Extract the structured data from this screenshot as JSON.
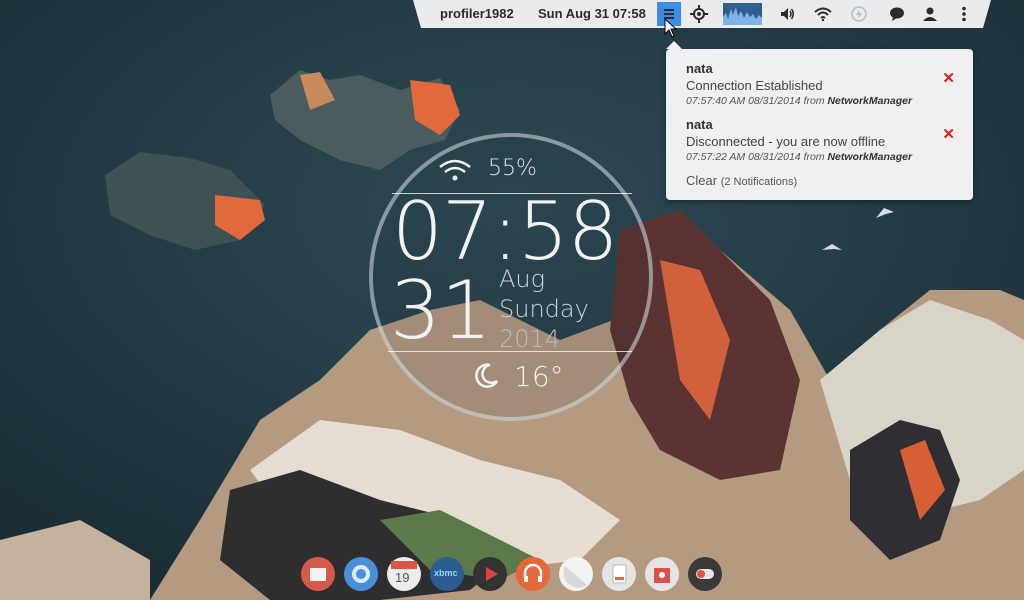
{
  "panel": {
    "user": "profiler1982",
    "datetime": "Sun Aug 31 07:58",
    "icons": [
      "menu-icon",
      "location-icon",
      "system-monitor-graph",
      "volume-icon",
      "wifi-icon",
      "power-icon",
      "chat-icon",
      "user-icon",
      "more-icon"
    ]
  },
  "notifications": {
    "items": [
      {
        "sender": "nata",
        "body": "Connection Established",
        "time": "07:57:40 AM 08/31/2014",
        "from_word": "from",
        "source": "NetworkManager"
      },
      {
        "sender": "nata",
        "body": "Disconnected - you are now offline",
        "time": "07:57:22 AM 08/31/2014",
        "from_word": "from",
        "source": "NetworkManager"
      }
    ],
    "clear_label": "Clear",
    "count_label": "(2 Notifications)"
  },
  "clock": {
    "wifi_percent": "55%",
    "time_hours": "07",
    "time_sep": ":",
    "time_minutes": "58",
    "day": "31",
    "month": "Aug",
    "weekday": "Sunday",
    "year": "2014",
    "temperature": "16°"
  },
  "dock": {
    "items": [
      {
        "name": "files",
        "color": "#d9534a"
      },
      {
        "name": "chromium",
        "color": "#4a90d9"
      },
      {
        "name": "calendar",
        "color": "#e8e8e8",
        "label": "19"
      },
      {
        "name": "xbmc",
        "color": "#2d5d8f",
        "label": "xbmc"
      },
      {
        "name": "video",
        "color": "#333333"
      },
      {
        "name": "music",
        "color": "#e8673a"
      },
      {
        "name": "shape",
        "color": "#f2f2f2"
      },
      {
        "name": "document",
        "color": "#e4e4e4"
      },
      {
        "name": "software",
        "color": "#d9534a"
      },
      {
        "name": "toggle",
        "color": "#3a3a3a"
      }
    ]
  },
  "colors": {
    "accent": "#3d8ce3",
    "close": "#e0201c"
  }
}
